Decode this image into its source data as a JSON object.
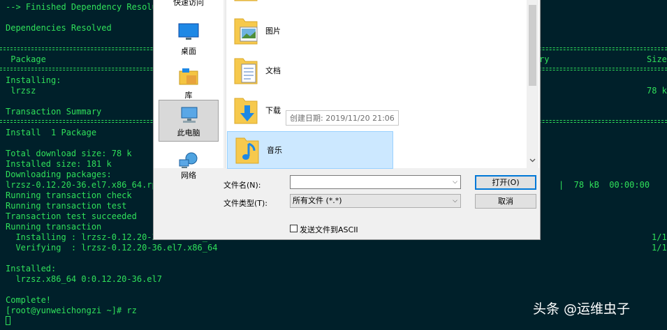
{
  "terminal": {
    "lines": [
      "--> Finished Dependency Resolu",
      "Dependencies Resolved",
      " Package",
      "Installing:",
      " lrzsz",
      "Transaction Summary",
      "Install  1 Package",
      "Total download size: 78 k",
      "Installed size: 181 k",
      "Downloading packages:",
      "lrzsz-0.12.20-36.el7.x86_64.rp",
      "Running transaction check",
      "Running transaction test",
      "Transaction test succeeded",
      "Running transaction",
      "  Installing : lrzsz-0.12.20-36.el7.x86_64",
      "  Verifying  : lrzsz-0.12.20-36.el7.x86_64",
      "Installed:",
      "  lrzsz.x86_64 0:0.12.20-36.el7",
      "Complete!",
      "[root@yunweichongzi ~]# rz"
    ],
    "right": {
      "repo_header_fragment": "ry",
      "size_header": "Size",
      "size_value": "78 k",
      "download_progress": "|  78 kB  00:00:00",
      "installing_count": "1/1",
      "verifying_count": "1/1"
    }
  },
  "dialog": {
    "nav": {
      "quick_access": "快速访问",
      "desktop": "桌面",
      "libraries": "库",
      "this_pc": "此电脑",
      "network": "网络"
    },
    "files": [
      {
        "label": "图片",
        "icon": "pictures-folder-icon"
      },
      {
        "label": "文档",
        "icon": "documents-folder-icon"
      },
      {
        "label": "下载",
        "icon": "downloads-folder-icon"
      },
      {
        "label": "音乐",
        "icon": "music-folder-icon"
      }
    ],
    "tooltip": "创建日期: 2019/11/20 21:06",
    "filename_label": "文件名(N):",
    "filename_value": "",
    "filetype_label": "文件类型(T):",
    "filetype_value": "所有文件 (*.*)",
    "open_button": "打开(O)",
    "cancel_button": "取消",
    "ascii_checkbox_label": "发送文件到ASCII",
    "ascii_checked": false
  },
  "watermark": "头条 @运维虫子",
  "colors": {
    "terminal_bg": "#00202a",
    "terminal_text": "#2fe05a",
    "selection": "#cce8ff",
    "accent": "#0078d7"
  }
}
